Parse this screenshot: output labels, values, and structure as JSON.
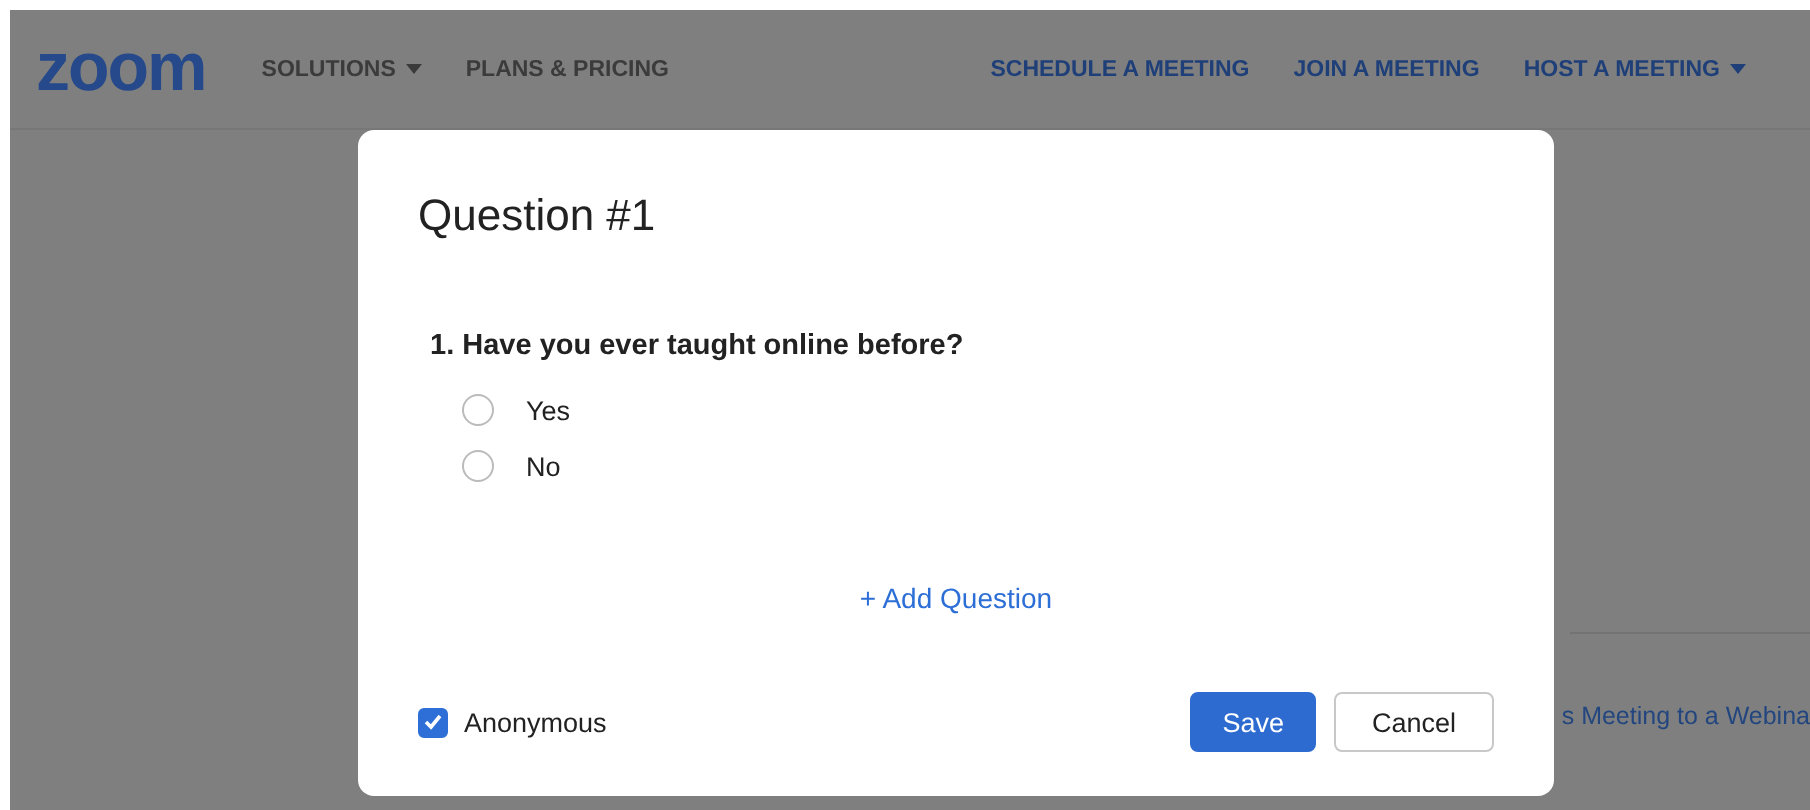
{
  "header": {
    "logo": "zoom",
    "nav": [
      {
        "label": "SOLUTIONS",
        "dropdown": true
      },
      {
        "label": "PLANS & PRICING",
        "dropdown": false
      }
    ],
    "actions": [
      {
        "label": "SCHEDULE A MEETING",
        "dropdown": false
      },
      {
        "label": "JOIN A MEETING",
        "dropdown": false
      },
      {
        "label": "HOST A MEETING",
        "dropdown": true
      }
    ]
  },
  "background_link": "s Meeting to a Webina",
  "dialog": {
    "title": "Question #1",
    "question": "1. Have you ever taught online before?",
    "options": [
      {
        "label": "Yes",
        "selected": false
      },
      {
        "label": "No",
        "selected": false
      }
    ],
    "add_question": "+ Add Question",
    "anonymous": {
      "label": "Anonymous",
      "checked": true
    },
    "buttons": [
      {
        "label": "Save",
        "kind": "primary"
      },
      {
        "label": "Cancel",
        "kind": "secondary"
      }
    ]
  }
}
